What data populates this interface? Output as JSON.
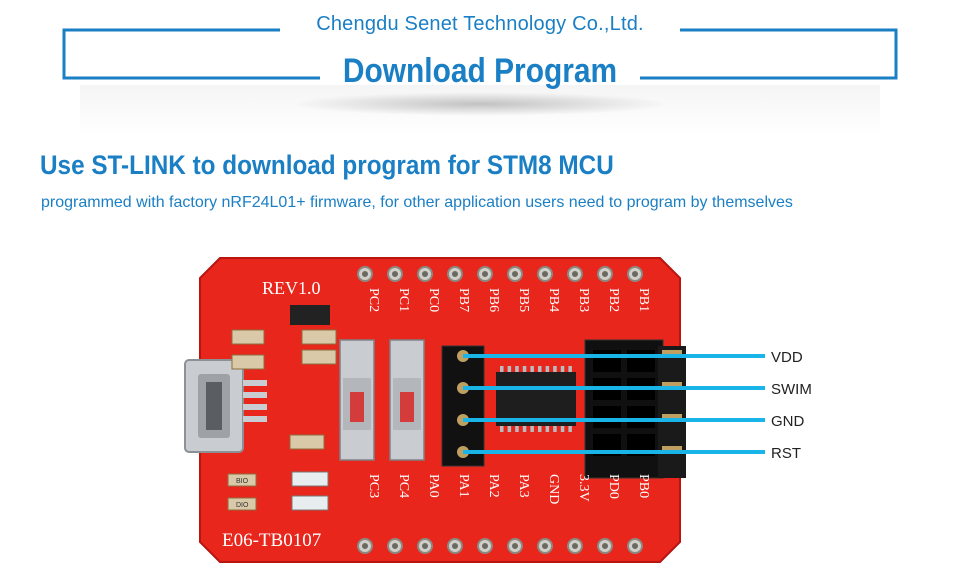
{
  "header": {
    "company": "Chengdu Senet Technology Co.,Ltd.",
    "title": "Download Program"
  },
  "section": {
    "title": "Use ST-LINK to download program for STM8 MCU",
    "subtitle": "programmed with factory nRF24L01+ firmware, for other application users need to program by themselves"
  },
  "board": {
    "revision": "REV1.0",
    "model": "E06-TB0107",
    "top_pins": [
      "PC2",
      "PC1",
      "PC0",
      "PB7",
      "PB6",
      "PB5",
      "PB4",
      "PB3",
      "PB2",
      "PB1"
    ],
    "bottom_pins": [
      "PC3",
      "PC4",
      "PA0",
      "PA1",
      "PA2",
      "PA3",
      "GND",
      "3.3V",
      "PD0",
      "PB0"
    ],
    "led_labels": [
      "BIO",
      "DIO"
    ]
  },
  "signals": [
    {
      "label": "VDD"
    },
    {
      "label": "SWIM"
    },
    {
      "label": "GND"
    },
    {
      "label": "RST"
    }
  ],
  "colors": {
    "accent": "#1a7fc4",
    "board_red": "#e8261c",
    "signal_line": "#19b5e8"
  }
}
